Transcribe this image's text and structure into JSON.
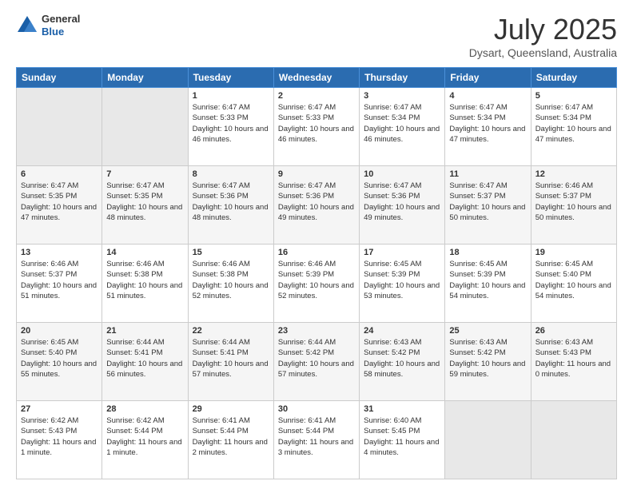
{
  "header": {
    "logo_general": "General",
    "logo_blue": "Blue",
    "month_year": "July 2025",
    "location": "Dysart, Queensland, Australia"
  },
  "days_of_week": [
    "Sunday",
    "Monday",
    "Tuesday",
    "Wednesday",
    "Thursday",
    "Friday",
    "Saturday"
  ],
  "weeks": [
    [
      {
        "day": "",
        "info": ""
      },
      {
        "day": "",
        "info": ""
      },
      {
        "day": "1",
        "info": "Sunrise: 6:47 AM\nSunset: 5:33 PM\nDaylight: 10 hours and 46 minutes."
      },
      {
        "day": "2",
        "info": "Sunrise: 6:47 AM\nSunset: 5:33 PM\nDaylight: 10 hours and 46 minutes."
      },
      {
        "day": "3",
        "info": "Sunrise: 6:47 AM\nSunset: 5:34 PM\nDaylight: 10 hours and 46 minutes."
      },
      {
        "day": "4",
        "info": "Sunrise: 6:47 AM\nSunset: 5:34 PM\nDaylight: 10 hours and 47 minutes."
      },
      {
        "day": "5",
        "info": "Sunrise: 6:47 AM\nSunset: 5:34 PM\nDaylight: 10 hours and 47 minutes."
      }
    ],
    [
      {
        "day": "6",
        "info": "Sunrise: 6:47 AM\nSunset: 5:35 PM\nDaylight: 10 hours and 47 minutes."
      },
      {
        "day": "7",
        "info": "Sunrise: 6:47 AM\nSunset: 5:35 PM\nDaylight: 10 hours and 48 minutes."
      },
      {
        "day": "8",
        "info": "Sunrise: 6:47 AM\nSunset: 5:36 PM\nDaylight: 10 hours and 48 minutes."
      },
      {
        "day": "9",
        "info": "Sunrise: 6:47 AM\nSunset: 5:36 PM\nDaylight: 10 hours and 49 minutes."
      },
      {
        "day": "10",
        "info": "Sunrise: 6:47 AM\nSunset: 5:36 PM\nDaylight: 10 hours and 49 minutes."
      },
      {
        "day": "11",
        "info": "Sunrise: 6:47 AM\nSunset: 5:37 PM\nDaylight: 10 hours and 50 minutes."
      },
      {
        "day": "12",
        "info": "Sunrise: 6:46 AM\nSunset: 5:37 PM\nDaylight: 10 hours and 50 minutes."
      }
    ],
    [
      {
        "day": "13",
        "info": "Sunrise: 6:46 AM\nSunset: 5:37 PM\nDaylight: 10 hours and 51 minutes."
      },
      {
        "day": "14",
        "info": "Sunrise: 6:46 AM\nSunset: 5:38 PM\nDaylight: 10 hours and 51 minutes."
      },
      {
        "day": "15",
        "info": "Sunrise: 6:46 AM\nSunset: 5:38 PM\nDaylight: 10 hours and 52 minutes."
      },
      {
        "day": "16",
        "info": "Sunrise: 6:46 AM\nSunset: 5:39 PM\nDaylight: 10 hours and 52 minutes."
      },
      {
        "day": "17",
        "info": "Sunrise: 6:45 AM\nSunset: 5:39 PM\nDaylight: 10 hours and 53 minutes."
      },
      {
        "day": "18",
        "info": "Sunrise: 6:45 AM\nSunset: 5:39 PM\nDaylight: 10 hours and 54 minutes."
      },
      {
        "day": "19",
        "info": "Sunrise: 6:45 AM\nSunset: 5:40 PM\nDaylight: 10 hours and 54 minutes."
      }
    ],
    [
      {
        "day": "20",
        "info": "Sunrise: 6:45 AM\nSunset: 5:40 PM\nDaylight: 10 hours and 55 minutes."
      },
      {
        "day": "21",
        "info": "Sunrise: 6:44 AM\nSunset: 5:41 PM\nDaylight: 10 hours and 56 minutes."
      },
      {
        "day": "22",
        "info": "Sunrise: 6:44 AM\nSunset: 5:41 PM\nDaylight: 10 hours and 57 minutes."
      },
      {
        "day": "23",
        "info": "Sunrise: 6:44 AM\nSunset: 5:42 PM\nDaylight: 10 hours and 57 minutes."
      },
      {
        "day": "24",
        "info": "Sunrise: 6:43 AM\nSunset: 5:42 PM\nDaylight: 10 hours and 58 minutes."
      },
      {
        "day": "25",
        "info": "Sunrise: 6:43 AM\nSunset: 5:42 PM\nDaylight: 10 hours and 59 minutes."
      },
      {
        "day": "26",
        "info": "Sunrise: 6:43 AM\nSunset: 5:43 PM\nDaylight: 11 hours and 0 minutes."
      }
    ],
    [
      {
        "day": "27",
        "info": "Sunrise: 6:42 AM\nSunset: 5:43 PM\nDaylight: 11 hours and 1 minute."
      },
      {
        "day": "28",
        "info": "Sunrise: 6:42 AM\nSunset: 5:44 PM\nDaylight: 11 hours and 1 minute."
      },
      {
        "day": "29",
        "info": "Sunrise: 6:41 AM\nSunset: 5:44 PM\nDaylight: 11 hours and 2 minutes."
      },
      {
        "day": "30",
        "info": "Sunrise: 6:41 AM\nSunset: 5:44 PM\nDaylight: 11 hours and 3 minutes."
      },
      {
        "day": "31",
        "info": "Sunrise: 6:40 AM\nSunset: 5:45 PM\nDaylight: 11 hours and 4 minutes."
      },
      {
        "day": "",
        "info": ""
      },
      {
        "day": "",
        "info": ""
      }
    ]
  ]
}
